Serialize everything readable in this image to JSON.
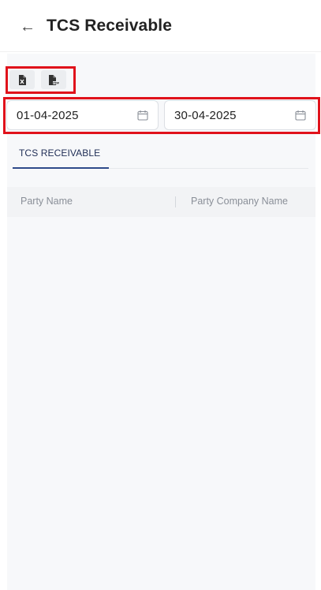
{
  "header": {
    "back_icon": "arrow-left-icon",
    "title": "TCS Receivable"
  },
  "toolbar": {
    "export_excel_icon": "excel-file-icon",
    "export_pdf_icon": "pdf-file-icon",
    "highlight_color": "#e0121b"
  },
  "filters": {
    "from_date": "01-04-2025",
    "to_date": "30-04-2025",
    "calendar_icon": "calendar-icon"
  },
  "tabs": [
    {
      "label": "TCS RECEIVABLE",
      "active": true
    }
  ],
  "table": {
    "columns": [
      "Party Name",
      "Party Company Name"
    ],
    "rows": []
  },
  "colors": {
    "accent": "#2f4a8a",
    "header_text": "#8a8f98",
    "panel_bg": "#f7f8fa"
  }
}
